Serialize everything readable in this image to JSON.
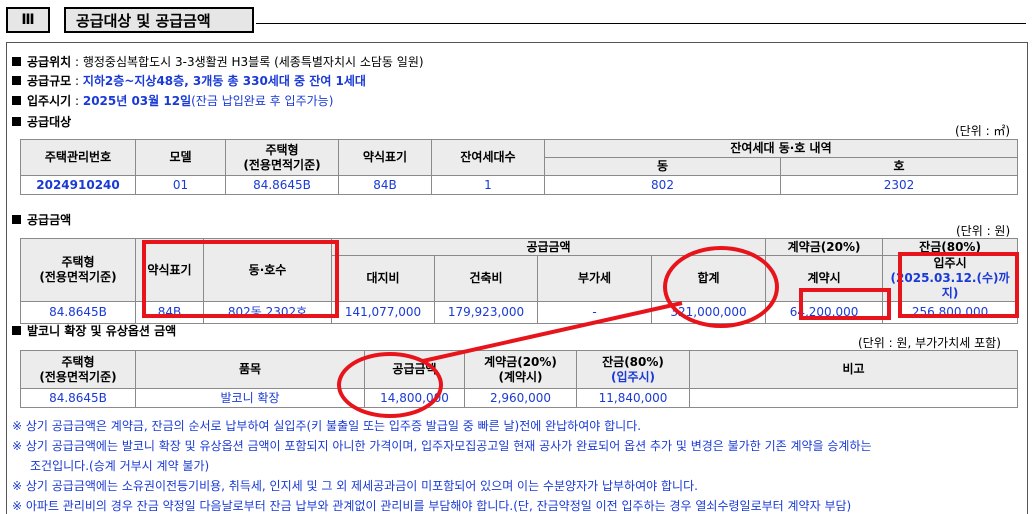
{
  "section": {
    "number": "Ⅲ",
    "title": "공급대상 및 공급금액"
  },
  "info": [
    {
      "label": "공급위치",
      "value": "행정중심복합도시 3-3생활권 H3블록 (세종특별자치시 소담동 일원)",
      "value_style": "plain",
      "suffix": ""
    },
    {
      "label": "공급규모",
      "value": "지하2층~지상48층, 3개동 총 330세대 중 잔여 1세대",
      "value_style": "blue",
      "suffix": ""
    },
    {
      "label": "입주시기",
      "value": "2025년 03월 12일",
      "value_style": "blue",
      "suffix": "(잔금 납입완료 후 입주가능)"
    }
  ],
  "supply_target": {
    "heading": "공급대상",
    "unit": "(단위 : ㎡)",
    "headers": {
      "mgmt_no": "주택관리번호",
      "model": "모델",
      "type_l1": "주택형",
      "type_l2": "(전용면적기준)",
      "abbr": "약식표기",
      "remaining": "잔여세대수",
      "details": "잔여세대 동·호 내역",
      "dong": "동",
      "ho": "호"
    },
    "row": {
      "mgmt_no": "2024910240",
      "model": "01",
      "type": "84.8645B",
      "abbr": "84B",
      "remaining": "1",
      "dong": "802",
      "ho": "2302"
    }
  },
  "supply_price": {
    "heading": "공급금액",
    "unit": "(단위 : 원)",
    "headers": {
      "type_l1": "주택형",
      "type_l2": "(전용면적기준)",
      "abbr": "약식표기",
      "unit_no": "동·호수",
      "price": "공급금액",
      "land": "대지비",
      "building": "건축비",
      "vat": "부가세",
      "total": "합계",
      "deposit": "계약금(20%)",
      "deposit_sub": "계약시",
      "balance": "잔금(80%)",
      "balance_sub": "입주시",
      "balance_date": "(2025.03.12.(수)까지)"
    },
    "row": {
      "type": "84.8645B",
      "abbr": "84B",
      "unit_no": "802동 2302호",
      "land": "141,077,000",
      "building": "179,923,000",
      "vat": "-",
      "total": "321,000,000",
      "deposit": "64,200,000",
      "balance": "256,800,000"
    }
  },
  "balcony": {
    "heading": "발코니 확장 및 유상옵션 금액",
    "unit": "(단위 : 원, 부가가치세 포함)",
    "headers": {
      "type_l1": "주택형",
      "type_l2": "(전용면적기준)",
      "item": "품목",
      "price": "공급금액",
      "deposit_l1": "계약금(20%)",
      "deposit_l2": "(계약시)",
      "balance_l1": "잔금(80%)",
      "balance_l2": "(입주시)",
      "remarks": "비고"
    },
    "row": {
      "type": "84.8645B",
      "item": "발코니 확장",
      "price": "14,800,000",
      "deposit": "2,960,000",
      "balance": "11,840,000",
      "remarks": ""
    }
  },
  "notes": [
    {
      "text": "※ 상기 공급금액은 계약금, 잔금의 순서로 납부하여 실입주(키 불출일 또는 입주증 발급일 중 빠른 날)전에 완납하여야 합니다.",
      "indent": false
    },
    {
      "text": "※ 상기 공급금액에는 발코니 확장 및 유상옵션 금액이 포함되지 아니한 가격이며, 입주자모집공고일 현재 공사가 완료되어 옵션 추가 및 변경은 불가한 기존 계약을 승계하는",
      "indent": false
    },
    {
      "text": "조건입니다.(승계 거부시 계약 불가)",
      "indent": true
    },
    {
      "text": "※ 상기 공급금액에는 소유권이전등기비용, 취득세, 인지세 및 그 외 제세공과금이 미포함되어 있으며 이는 수분양자가 납부하여야 합니다.",
      "indent": false
    },
    {
      "text": "※ 아파트 관리비의 경우 잔금 약정일 다음날로부터 잔금 납부와 관계없이 관리비를 부담해야 합니다.(단, 잔금약정일 이전 입주하는 경우 열쇠수령일로부터 계약자 부담)",
      "indent": false
    }
  ],
  "colors": {
    "accent_blue": "#1a3ad6",
    "annotation_red": "#e8141b",
    "header_gray": "#ececec"
  }
}
